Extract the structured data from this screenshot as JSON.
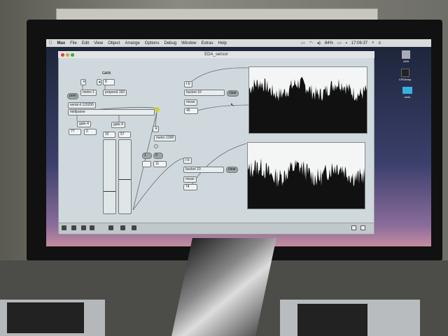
{
  "menubar": {
    "apple": "",
    "app": "Max",
    "items": [
      "File",
      "Edit",
      "View",
      "Object",
      "Arrange",
      "Options",
      "Debug",
      "Window",
      "Extras",
      "Help"
    ],
    "battery": "84%",
    "clock": "17:06:37"
  },
  "window": {
    "title": "EDA_sensor"
  },
  "patch": {
    "gain_label": "GAIN",
    "gain_value": "8",
    "metro1": "metro 1",
    "prepend": "prepend 193",
    "print": "print",
    "serial": "serial d 115200",
    "midiparse": "midiparse",
    "gate_a": "gate 4",
    "gate_b": "gate 4",
    "num_a1": "77",
    "num_a2": "0",
    "num_b1": "32",
    "num_b2": "57",
    "metro1000": "metro 1000",
    "msg_1": "1",
    "msg_0": "0",
    "num_c1": "",
    "num_c2": "11",
    "top": {
      "tb": "t b",
      "bucket": "bucket 10",
      "clear": "clear",
      "mean": "mean",
      "value": "46"
    },
    "bottom": {
      "tb": "t b",
      "bucket": "bucket 10",
      "clear": "clear",
      "mean": "mean",
      "value": "74"
    },
    "meters": [
      0.3,
      0.46
    ]
  },
  "dock": {
    "items": [
      "AKB",
      "CPUtemp",
      "work"
    ]
  },
  "colors": {
    "accent": "#c8d23a",
    "window": "#cfd9dd"
  }
}
